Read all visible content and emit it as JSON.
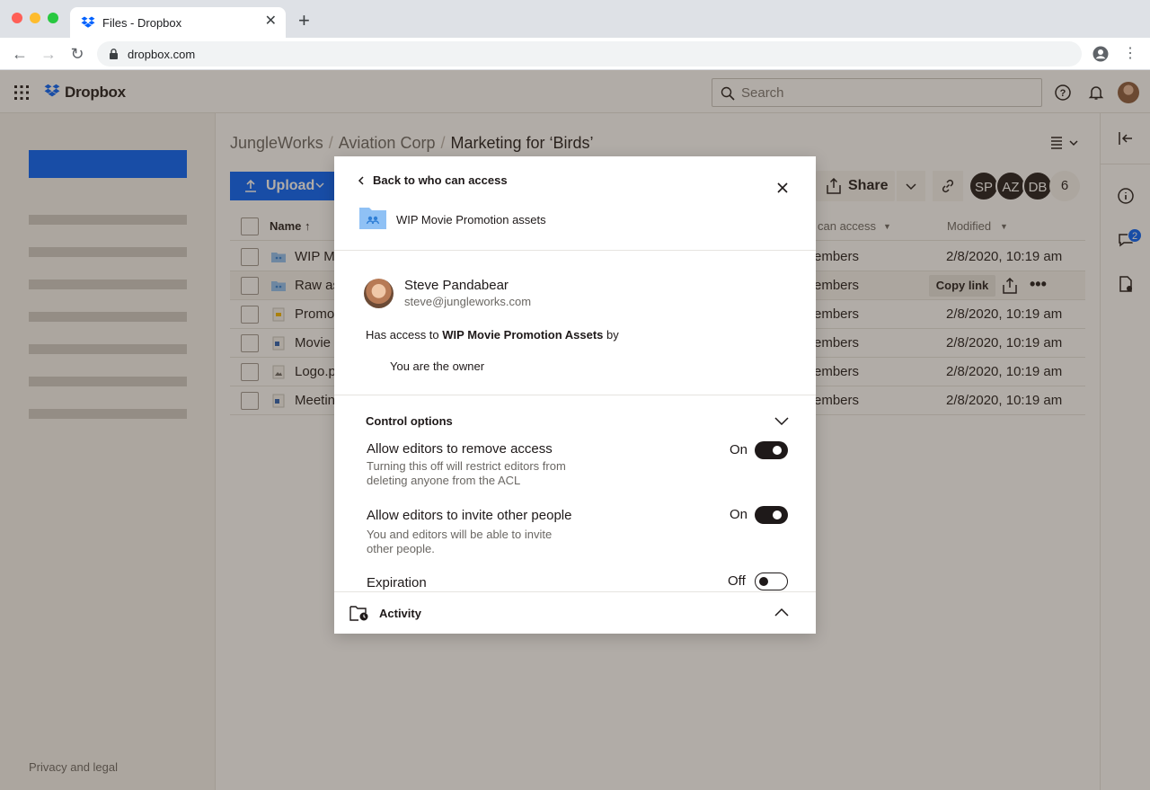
{
  "browser": {
    "tab_title": "Files - Dropbox",
    "url": "dropbox.com"
  },
  "app": {
    "brand": "Dropbox",
    "search_placeholder": "Search"
  },
  "sidebar": {
    "footer_link": "Privacy and legal"
  },
  "main": {
    "breadcrumbs": [
      "JungleWorks",
      "Aviation Corp",
      "Marketing for ‘Birds’"
    ],
    "upload_label": "Upload",
    "share_label": "Share",
    "members": [
      "SP",
      "AZ",
      "DB"
    ],
    "members_more": "6",
    "columns": {
      "name": "Name ↑",
      "access": "can access",
      "modified": "Modified"
    },
    "rows": [
      {
        "name": "WIP M",
        "access": "embers",
        "modified": "2/8/2020, 10:19 am"
      },
      {
        "name": "Raw as",
        "access": "embers",
        "modified": "2/8/2020, 10:19 am"
      },
      {
        "name": "Promo",
        "access": "embers",
        "modified": "2/8/2020, 10:19 am"
      },
      {
        "name": "Movie",
        "access": "embers",
        "modified": "2/8/2020, 10:19 am"
      },
      {
        "name": "Logo.p",
        "access": "embers",
        "modified": "2/8/2020, 10:19 am"
      },
      {
        "name": "Meetin",
        "access": "embers",
        "modified": "2/8/2020, 10:19 am"
      }
    ],
    "copy_link_label": "Copy link"
  },
  "rail": {
    "comments_badge": "2"
  },
  "modal": {
    "back_label": "Back to who can access",
    "folder_name": "WIP Movie Promotion assets",
    "user_name": "Steve Pandabear",
    "user_email": "steve@jungleworks.com",
    "access_prefix": "Has access to ",
    "access_target": "WIP Movie Promotion Assets",
    "access_suffix": " by",
    "owner_line": "You are the owner",
    "control_heading": "Control options",
    "options": [
      {
        "title": "Allow editors to remove access",
        "desc": "Turning this off will restrict editors from deleting anyone from the ACL",
        "state": "On",
        "enabled": true
      },
      {
        "title": "Allow editors to invite other people",
        "desc": "You and editors will be able to invite other people.",
        "state": "On",
        "enabled": true
      },
      {
        "title": "Expiration",
        "desc": "",
        "state": "Off",
        "enabled": false
      }
    ],
    "activity_label": "Activity"
  },
  "colors": {
    "brand_blue": "#0061fe",
    "ink": "#1e1919",
    "muted": "#6a6763"
  }
}
